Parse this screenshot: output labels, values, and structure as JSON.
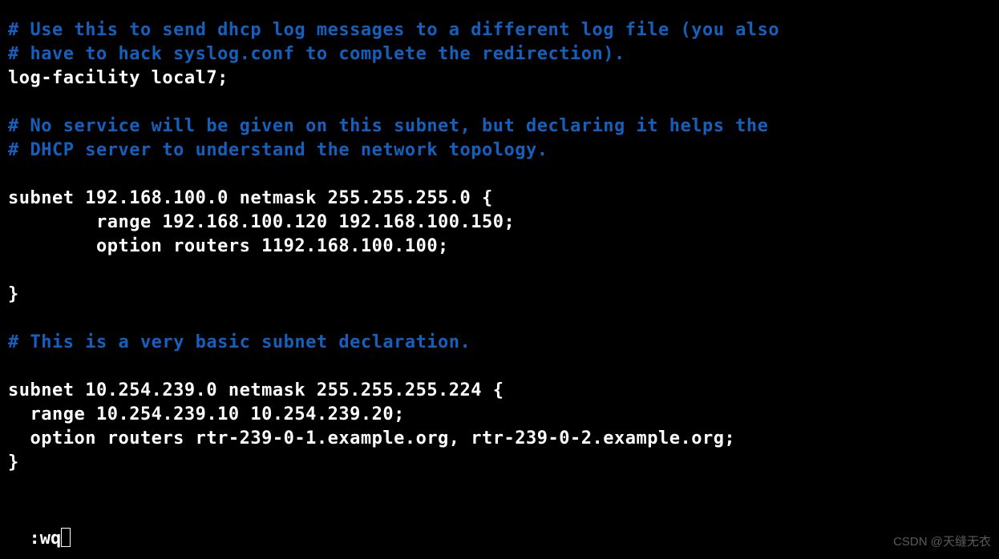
{
  "lines": [
    {
      "cls": "comment",
      "text": "# Use this to send dhcp log messages to a different log file (you also"
    },
    {
      "cls": "comment",
      "text": "# have to hack syslog.conf to complete the redirection)."
    },
    {
      "cls": "normal",
      "text": "log-facility local7;"
    },
    {
      "cls": "normal",
      "text": ""
    },
    {
      "cls": "comment",
      "text": "# No service will be given on this subnet, but declaring it helps the"
    },
    {
      "cls": "comment",
      "text": "# DHCP server to understand the network topology."
    },
    {
      "cls": "normal",
      "text": ""
    },
    {
      "cls": "normal",
      "text": "subnet 192.168.100.0 netmask 255.255.255.0 {"
    },
    {
      "cls": "normal",
      "text": "        range 192.168.100.120 192.168.100.150;"
    },
    {
      "cls": "normal",
      "text": "        option routers 1192.168.100.100;"
    },
    {
      "cls": "normal",
      "text": ""
    },
    {
      "cls": "normal",
      "text": "}"
    },
    {
      "cls": "normal",
      "text": ""
    },
    {
      "cls": "comment",
      "text": "# This is a very basic subnet declaration."
    },
    {
      "cls": "normal",
      "text": ""
    },
    {
      "cls": "normal",
      "text": "subnet 10.254.239.0 netmask 255.255.255.224 {"
    },
    {
      "cls": "normal",
      "text": "  range 10.254.239.10 10.254.239.20;"
    },
    {
      "cls": "normal",
      "text": "  option routers rtr-239-0-1.example.org, rtr-239-0-2.example.org;"
    },
    {
      "cls": "normal",
      "text": "}"
    }
  ],
  "command": ":wq",
  "watermark": "CSDN @天缝无衣"
}
